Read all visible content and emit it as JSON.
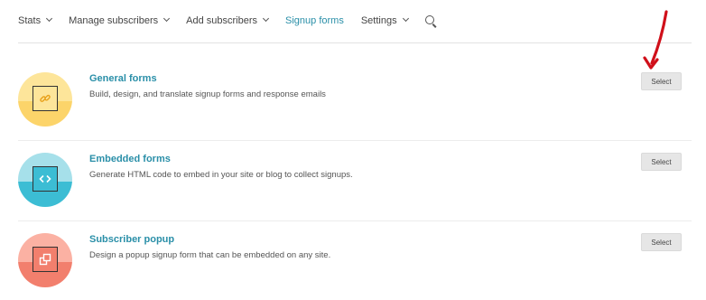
{
  "nav": {
    "items": [
      {
        "label": "Stats",
        "has_dropdown": true,
        "active": false
      },
      {
        "label": "Manage subscribers",
        "has_dropdown": true,
        "active": false
      },
      {
        "label": "Add subscribers",
        "has_dropdown": true,
        "active": false
      },
      {
        "label": "Signup forms",
        "has_dropdown": false,
        "active": true
      },
      {
        "label": "Settings",
        "has_dropdown": true,
        "active": false
      }
    ],
    "search_icon": "search-icon",
    "active_color": "#2a8fa8"
  },
  "forms": [
    {
      "title": "General forms",
      "description": "Build, design, and translate signup forms and response emails",
      "icon": "link-icon",
      "badge_colors": [
        "#fde59a",
        "#fcd46a"
      ],
      "button_label": "Select"
    },
    {
      "title": "Embedded forms",
      "description": "Generate HTML code to embed in your site or blog to collect signups.",
      "icon": "code-icon",
      "badge_colors": [
        "#a6e0ea",
        "#3cbdd4"
      ],
      "button_label": "Select"
    },
    {
      "title": "Subscriber popup",
      "description": "Design a popup signup form that can be embedded on any site.",
      "icon": "popup-icon",
      "badge_colors": [
        "#fbb1a3",
        "#f27f6d"
      ],
      "button_label": "Select"
    }
  ],
  "annotation": {
    "color": "#d0101a",
    "icon": "red-arrow-icon"
  }
}
